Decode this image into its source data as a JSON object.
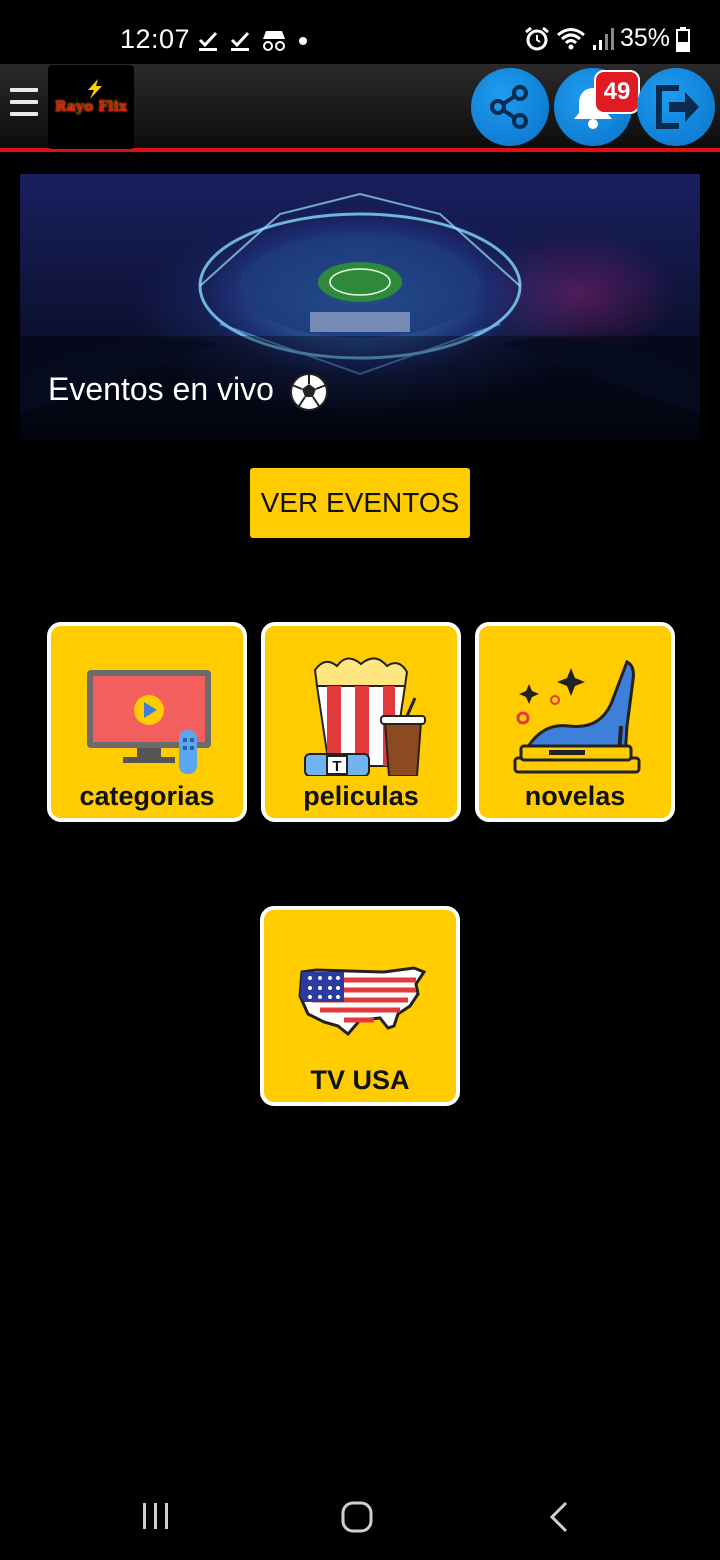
{
  "status": {
    "time": "12:07",
    "battery": "35%"
  },
  "appbar": {
    "logo_text": "Rayo Flix",
    "notification_count": "49"
  },
  "banner": {
    "title": "Eventos en vivo"
  },
  "main": {
    "ver_eventos": "VER EVENTOS",
    "cards": [
      {
        "label": "categorias",
        "icon": "tv-remote-icon"
      },
      {
        "label": "peliculas",
        "icon": "popcorn-icon"
      },
      {
        "label": "novelas",
        "icon": "high-heel-icon"
      },
      {
        "label": "TV USA",
        "icon": "usa-map-icon"
      }
    ]
  },
  "colors": {
    "accent": "#ffcc00",
    "appbar_line": "#e01010",
    "circle_buttons": "#1e9cf0",
    "badge": "#e11b22"
  }
}
